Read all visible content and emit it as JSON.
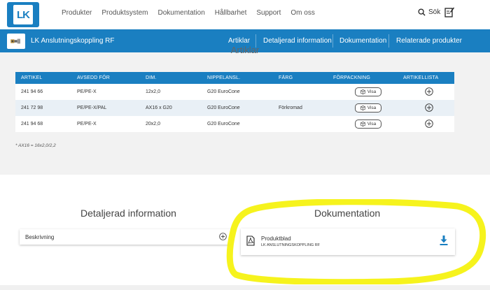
{
  "header": {
    "logo_text": "LK",
    "nav": [
      "Produkter",
      "Produktsystem",
      "Dokumentation",
      "Hållbarhet",
      "Support",
      "Om oss"
    ],
    "search_label": "Sök"
  },
  "product_bar": {
    "title": "LK Anslutningskoppling RF",
    "tabs": [
      "Artiklar",
      "Detaljerad information",
      "Dokumentation",
      "Relaterade produkter"
    ]
  },
  "articles": {
    "heading": "Artiklar",
    "columns": [
      "ARTIKEL",
      "AVSEDD FÖR",
      "DIM.",
      "NIPPELANSL.",
      "FÄRG",
      "FÖRPACKNING",
      "ARTIKELLISTA"
    ],
    "rows": [
      {
        "artikel": "241 94 66",
        "avsedd": "PE/PE-X",
        "dim": "12x2,0",
        "nippel": "G20 EuroCone",
        "farg": "",
        "visa": "Visa"
      },
      {
        "artikel": "241 72 98",
        "avsedd": "PE/PE-X/PAL",
        "dim": "AX16 x G20",
        "nippel": "G20 EuroCone",
        "farg": "Förkromad",
        "visa": "Visa"
      },
      {
        "artikel": "241 94 68",
        "avsedd": "PE/PE-X",
        "dim": "20x2,0",
        "nippel": "G20 EuroCone",
        "farg": "",
        "visa": "Visa"
      }
    ],
    "footnote": "* AX16 = 16x2,0/2,2"
  },
  "details": {
    "heading": "Detaljerad information",
    "items": [
      "Beskrivning"
    ]
  },
  "documentation": {
    "heading": "Dokumentation",
    "doc_title": "Produktblad",
    "doc_subtitle": "LK ANSLUTNINGSKOPPLING RF"
  },
  "colors": {
    "brand_blue": "#1a7fc1",
    "highlight": "#f5f20a"
  },
  "icons": [
    "search-icon",
    "edit-icon",
    "box-icon",
    "plus-circle-icon",
    "pdf-icon",
    "download-icon"
  ]
}
